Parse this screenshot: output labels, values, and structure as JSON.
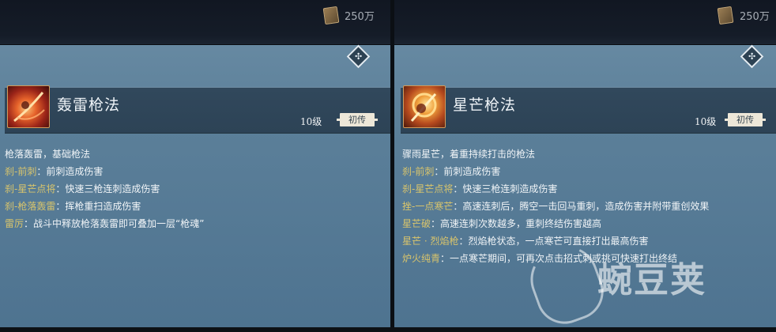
{
  "watermark": "蜿豆荚",
  "panels": [
    {
      "money": "250万",
      "skill": {
        "name": "轰雷枪法",
        "level": "10级",
        "rank": "初传",
        "intro": "枪落轰雷，基础枪法",
        "moves": [
          {
            "name": "刹-前刺",
            "sep": "：",
            "desc": "前刺造成伤害"
          },
          {
            "name": "刹-星芒点将",
            "sep": "：",
            "desc": "快速三枪连刺造成伤害"
          },
          {
            "name": "刹-枪落轰雷",
            "sep": "：",
            "desc": "挥枪重扫造成伤害"
          },
          {
            "name": "雷厉",
            "sep": "：",
            "desc": "战斗中释放枪落轰雷即可叠加一层“枪魂”"
          }
        ]
      }
    },
    {
      "money": "250万",
      "skill": {
        "name": "星芒枪法",
        "level": "10级",
        "rank": "初传",
        "intro": "骤雨星芒，着重持续打击的枪法",
        "moves": [
          {
            "name": "刹-前刺",
            "sep": "：",
            "desc": "前刺造成伤害"
          },
          {
            "name": "刹-星芒点将",
            "sep": "：",
            "desc": "快速三枪连刺造成伤害"
          },
          {
            "name": "挫-一点寒芒",
            "sep": "：",
            "desc": "高速连刺后，腾空一击回马重刺，造成伤害并附带重创效果"
          },
          {
            "name": "星芒破",
            "sep": "：",
            "desc": "高速连刺次数越多，重刺终结伤害越高"
          },
          {
            "name": "星芒 · 烈焰枪",
            "sep": "：",
            "desc": "烈焰枪状态，一点寒芒可直接打出最高伤害"
          },
          {
            "name": "炉火纯青",
            "sep": "：",
            "desc": "一点寒芒期间，可再次点击招式刺或挑可快速打出终结"
          }
        ]
      }
    }
  ]
}
